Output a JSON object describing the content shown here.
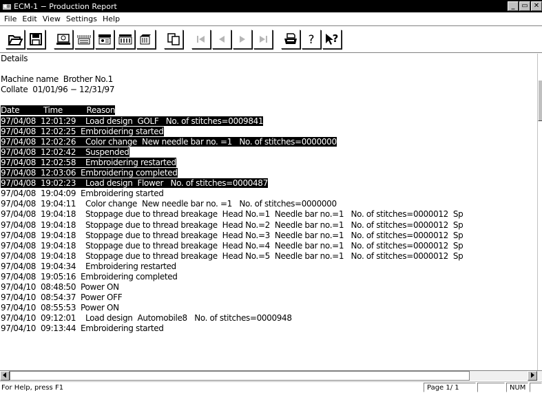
{
  "window": {
    "title": "ECM-1 − Production Report",
    "controls": [
      "_",
      "▭",
      "✕"
    ]
  },
  "menu": [
    "File",
    "Edit",
    "View",
    "Settings",
    "Help"
  ],
  "toolbar": {
    "buttons": [
      {
        "name": "open-icon"
      },
      {
        "name": "save-icon"
      },
      {
        "name": "machine-info-icon"
      },
      {
        "name": "stitch-report-icon"
      },
      {
        "name": "report-view-icon"
      },
      {
        "name": "production-icon"
      },
      {
        "name": "multi-machine-icon"
      },
      {
        "name": "copy-icon"
      },
      {
        "name": "first-page-icon"
      },
      {
        "name": "prev-page-icon"
      },
      {
        "name": "next-page-icon"
      },
      {
        "name": "last-page-icon"
      },
      {
        "name": "print-icon"
      },
      {
        "name": "help-icon"
      },
      {
        "name": "context-help-icon"
      }
    ]
  },
  "report": {
    "heading": "Details",
    "machine_name": "Machine name  Brother No.1",
    "collate": "Collate  01/01/96 − 12/31/97",
    "header": "Date          Time          Reason",
    "rows": [
      {
        "text": "97/04/08  12:01:29    Load design  GOLF   No. of stitches=0009841",
        "hl": true
      },
      {
        "text": "97/04/08  12:02:25  Embroidering started",
        "hl": true
      },
      {
        "text": "97/04/08  12:02:26    Color change  New needle bar no. =1   No. of stitches=0000000",
        "hl": true
      },
      {
        "text": "97/04/08  12:02:42    Suspended",
        "hl": true
      },
      {
        "text": "97/04/08  12:02:58    Embroidering restarted",
        "hl": true
      },
      {
        "text": "97/04/08  12:03:06  Embroidering completed",
        "hl": true
      },
      {
        "text": "97/04/08  19:02:23    Load design  Flower   No. of stitches=0000487",
        "hl": true
      },
      {
        "text": "97/04/08  19:04:09  Embroidering started",
        "hl": false
      },
      {
        "text": "97/04/08  19:04:11    Color change  New needle bar no. =1   No. of stitches=0000000",
        "hl": false
      },
      {
        "text": "97/04/08  19:04:18    Stoppage due to thread breakage  Head No.=1  Needle bar no.=1   No. of stitches=0000012  Sp",
        "hl": false
      },
      {
        "text": "97/04/08  19:04:18    Stoppage due to thread breakage  Head No.=2  Needle bar no.=1   No. of stitches=0000012  Sp",
        "hl": false
      },
      {
        "text": "97/04/08  19:04:18    Stoppage due to thread breakage  Head No.=3  Needle bar no.=1   No. of stitches=0000012  Sp",
        "hl": false
      },
      {
        "text": "97/04/08  19:04:18    Stoppage due to thread breakage  Head No.=4  Needle bar no.=1   No. of stitches=0000012  Sp",
        "hl": false
      },
      {
        "text": "97/04/08  19:04:18    Stoppage due to thread breakage  Head No.=5  Needle bar no.=1   No. of stitches=0000012  Sp",
        "hl": false
      },
      {
        "text": "97/04/08  19:04:34    Embroidering restarted",
        "hl": false
      },
      {
        "text": "97/04/08  19:05:16  Embroidering completed",
        "hl": false
      },
      {
        "text": "97/04/10  08:48:50  Power ON",
        "hl": false
      },
      {
        "text": "97/04/10  08:54:37  Power OFF",
        "hl": false
      },
      {
        "text": "97/04/10  08:55:53  Power ON",
        "hl": false
      },
      {
        "text": "97/04/10  09:12:01    Load design  Automobile8   No. of stitches=0000948",
        "hl": false
      },
      {
        "text": "97/04/10  09:13:44  Embroidering started",
        "hl": false
      }
    ]
  },
  "status": {
    "help_text": "For Help, press F1",
    "page": "Page   1/  1",
    "num": "NUM"
  },
  "colors": {
    "highlight_bg": "#000000",
    "highlight_fg": "#ffffff"
  }
}
